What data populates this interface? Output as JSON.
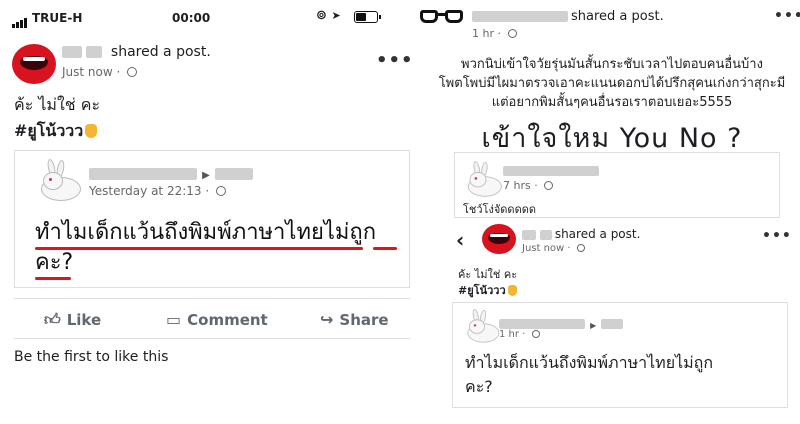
{
  "status_bar": {
    "carrier": "TRUE-H",
    "time": "00:00",
    "battery_level": 0.55
  },
  "left_post": {
    "author_suffix": "shared a post.",
    "timestamp": "Just now",
    "text_line1": "ค้ะ ไม่ใช่ คะ",
    "text_line2": "#ยูโน้ววว",
    "shared": {
      "timestamp": "Yesterday at 22:13",
      "question": "ทำไมเด็กแว้นถึงพิมพ์ภาษาไทยไม่ถูกคะ?"
    },
    "actions": {
      "like": "Like",
      "comment": "Comment",
      "share": "Share"
    },
    "likes_summary": "Be the first to like this"
  },
  "right_post": {
    "author_suffix": "shared a post.",
    "timestamp": "1 hr",
    "body_line1": "พวกนิบ่เข้าใจวัยรุ่นมันสั้นกระชับเวลาไปตอบคนอื่นบ้าง",
    "body_line2": "โพตโพบ่มีไผมาตรวจเอาคะแนนดอกบ่ได้ปรึกสุคนเก่งกว่าสุกะมี",
    "body_line3": "แต่อยากพิมสั้นๆคนอื่นรอเราตอบเยอะ5555",
    "headline": "เข้าใจใหม You No ?",
    "card1": {
      "timestamp": "7 hrs",
      "caption": "โชว์โง่จัดดดดด"
    },
    "screenshot": {
      "back": "‹",
      "author_suffix": "shared a post.",
      "timestamp": "Just now",
      "text_line1": "ค้ะ ไม่ใช่ คะ",
      "text_line2": "#ยูโน้ววว",
      "shared_timestamp": "1 hr",
      "question_line1": "ทำไมเด็กแว้นถึงพิมพ์ภาษาไทยไม่ถูก",
      "question_line2": "คะ?"
    }
  },
  "icons": {
    "more": "•••",
    "location": "➤",
    "like": "thumbs-up-icon",
    "comment": "comment-icon",
    "share": "share-arrow-icon"
  }
}
